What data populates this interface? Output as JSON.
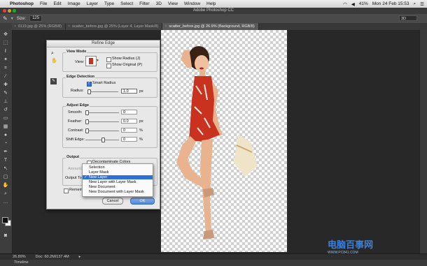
{
  "menubar": {
    "app": "Photoshop",
    "items": [
      "File",
      "Edit",
      "Image",
      "Layer",
      "Type",
      "Select",
      "Filter",
      "3D",
      "View",
      "Window",
      "Help"
    ],
    "battery": "41%",
    "datetime": "Mon 24 Feb  15:53"
  },
  "window": {
    "title": "Adobe Photoshop CC"
  },
  "options": {
    "size_label": "Size:",
    "size_value": "125",
    "workspace": "3D"
  },
  "tabs": [
    {
      "label": "0119.jpg @ 25% (RGB/8)"
    },
    {
      "label": "scatter_before.jpg @ 25% (Layer 4, Layer Mask/8)"
    },
    {
      "label": "scatter_before.jpg @ 26.9% (Background, RGB/8)"
    }
  ],
  "dialog": {
    "title": "Refine Edge",
    "view_mode": {
      "group": "View Mode",
      "view_label": "View:",
      "show_radius": "Show Radius (J)",
      "show_original": "Show Original (P)"
    },
    "edge_detection": {
      "group": "Edge Detection",
      "smart_radius": "Smart Radius",
      "radius_label": "Radius:",
      "radius_value": "1.0",
      "radius_unit": "px"
    },
    "adjust_edge": {
      "group": "Adjust Edge",
      "smooth_label": "Smooth:",
      "smooth_value": "0",
      "feather_label": "Feather:",
      "feather_value": "0.0",
      "feather_unit": "px",
      "contrast_label": "Contrast:",
      "contrast_value": "0",
      "contrast_unit": "%",
      "shift_label": "Shift Edge:",
      "shift_value": "0",
      "shift_unit": "%"
    },
    "output": {
      "group": "Output",
      "decontaminate": "Decontaminate Colors",
      "amount_label": "Amount:",
      "output_to_label": "Output To:",
      "remember": "Remember Settings"
    },
    "dropdown": {
      "options": [
        "Selection",
        "Layer Mask",
        "New Layer",
        "New Layer with Layer Mask",
        "New Document",
        "New Document with Layer Mask"
      ],
      "selected": "New Layer"
    },
    "cancel": "Cancel",
    "ok": "OK"
  },
  "status": {
    "zoom": "26.89%",
    "doc": "Doc: 60.2M/137.4M"
  },
  "timeline": "Timeline",
  "watermark": "电脑百事网",
  "watermark_url": "WWW.PC841.COM",
  "colors": {
    "selection_blue": "#2e6fd8",
    "dress_red": "#c8321e"
  }
}
